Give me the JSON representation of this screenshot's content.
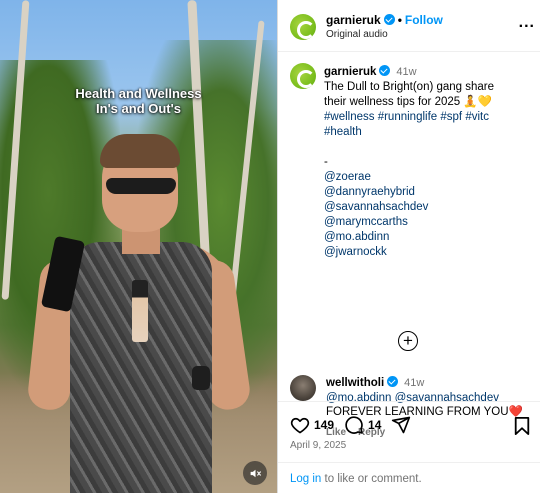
{
  "media": {
    "overlay_line1": "Health and Wellness",
    "overlay_line2": "In's and Out's",
    "mute_icon": "speaker-muted-icon"
  },
  "header": {
    "username": "garnieruk",
    "follow_label": "Follow",
    "audio_label": "Original audio",
    "more_label": "..."
  },
  "caption": {
    "username": "garnieruk",
    "time": "41w",
    "text_line1": "The Dull to Bright(on) gang share",
    "text_line2": "their wellness tips for 2025",
    "emojis": "🧘💛",
    "hashtags_line1": [
      "#wellness",
      "#runninglife",
      "#spf",
      "#vitc"
    ],
    "hashtags_line2": [
      "#health"
    ],
    "separator": "-",
    "mentions": [
      "@zoerae",
      "@dannyraehybrid",
      "@savannahsachdev",
      "@marymccarths",
      "@mo.abdinn",
      "@jwarnockk"
    ]
  },
  "comment": {
    "username": "wellwitholi",
    "time": "41w",
    "mention1": "@mo.abdinn",
    "mention2": "@savannahsachdev",
    "text": "FOREVER LEARNING FROM YOU",
    "emoji": "❤️",
    "like_label": "Like",
    "reply_label": "Reply"
  },
  "actions": {
    "likes": "149",
    "comments": "14",
    "date": "April 9, 2025"
  },
  "login": {
    "link": "Log in",
    "rest": " to like or comment."
  },
  "colors": {
    "link_blue": "#0095f6",
    "hashtag_blue": "#00376b",
    "verified_blue": "#0095f6",
    "brand_green": "#7cbf1e"
  }
}
